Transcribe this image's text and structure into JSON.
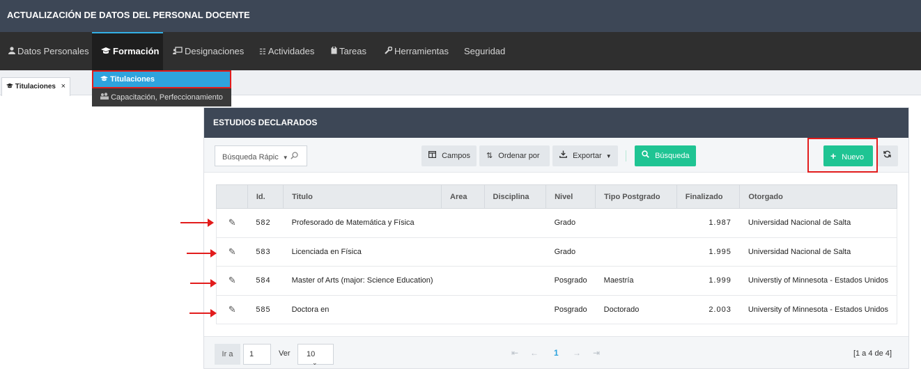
{
  "app": {
    "title": "ACTUALIZACIÓN DE DATOS DEL PERSONAL DOCENTE"
  },
  "menu": [
    {
      "label": "Datos Personales",
      "icon": "user-icon"
    },
    {
      "label": "Formación",
      "icon": "graduation-cap-icon",
      "active": true
    },
    {
      "label": "Designaciones",
      "icon": "presentation-icon"
    },
    {
      "label": "Actividades",
      "icon": "list-icon"
    },
    {
      "label": "Tareas",
      "icon": "clipboard-icon"
    },
    {
      "label": "Herramientas",
      "icon": "wrench-icon"
    },
    {
      "label": "Seguridad",
      "icon": ""
    }
  ],
  "submenu": [
    {
      "label": "Titulaciones",
      "icon": "graduation-cap-icon",
      "selected": true
    },
    {
      "label": "Capacitación, Perfeccionamiento",
      "icon": "users-icon"
    }
  ],
  "doc_tab": {
    "label": "Titulaciones",
    "close": "×"
  },
  "panel": {
    "title": "ESTUDIOS DECLARADOS",
    "search_placeholder": "Búsqueda Rápic",
    "btn_campos": "Campos",
    "btn_ordenar": "Ordenar por",
    "btn_exportar": "Exportar",
    "btn_busqueda": "Búsqueda",
    "btn_nuevo": "Nuevo"
  },
  "table": {
    "columns": [
      "Id.",
      "Titulo",
      "Area",
      "Disciplina",
      "Nivel",
      "Tipo Postgrado",
      "Finalizado",
      "Otorgado"
    ],
    "rows": [
      {
        "id": "582",
        "titulo": "Profesorado de Matemática y Física",
        "area": "",
        "disciplina": "",
        "nivel": "Grado",
        "tipo": "",
        "finalizado": "1.987",
        "otorgado": "Universidad Nacional de Salta"
      },
      {
        "id": "583",
        "titulo": "Licenciada en Física",
        "area": "",
        "disciplina": "",
        "nivel": "Grado",
        "tipo": "",
        "finalizado": "1.995",
        "otorgado": "Universidad Nacional de Salta"
      },
      {
        "id": "584",
        "titulo": "Master of Arts (major: Science Education)",
        "area": "",
        "disciplina": "",
        "nivel": "Posgrado",
        "tipo": "Maestría",
        "finalizado": "1.999",
        "otorgado": "Universtiy of Minnesota - Estados Unidos"
      },
      {
        "id": "585",
        "titulo": "Doctora en",
        "area": "",
        "disciplina": "",
        "nivel": "Posgrado",
        "tipo": "Doctorado",
        "finalizado": "2.003",
        "otorgado": "University of Minnesota - Estados Unidos"
      }
    ]
  },
  "pager": {
    "ira_label": "Ir a",
    "page_value": "1",
    "ver_label": "Ver",
    "per_page": "10",
    "current": "1",
    "info": "[1 a 4 de 4]"
  },
  "colors": {
    "header": "#3d4756",
    "accent": "#2ea3dd",
    "green": "#1fc493",
    "annotation": "#e21c1c"
  }
}
